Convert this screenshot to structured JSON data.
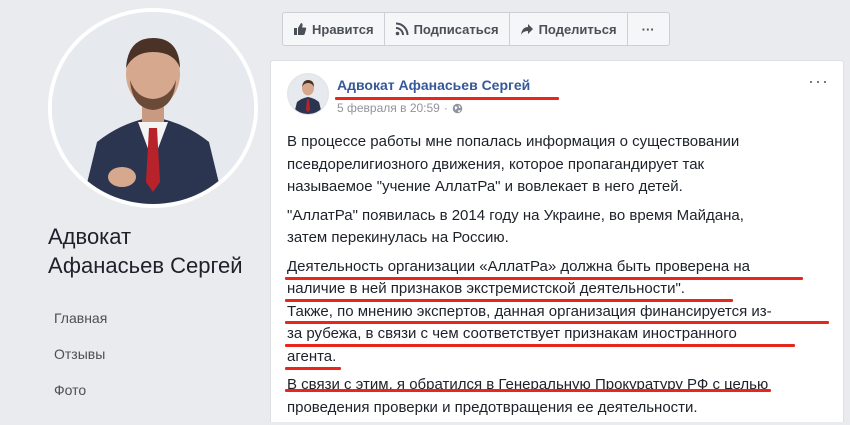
{
  "profile": {
    "name_line1": "Адвокат",
    "name_line2": "Афанасьев Сергей"
  },
  "nav": {
    "items": [
      "Главная",
      "Отзывы",
      "Фото"
    ]
  },
  "actions": {
    "like": "Нравится",
    "subscribe": "Подписаться",
    "share": "Поделиться",
    "more": "···"
  },
  "post": {
    "author": "Адвокат Афанасьев Сергей",
    "date": "5 февраля в 20:59",
    "more": "···",
    "paragraphs": [
      [
        "В процессе работы мне попалась информация о существовании",
        "псевдорелигиозного движения, которое пропагандирует так",
        "называемое \"учение АллатРа\" и вовлекает в него детей."
      ],
      [
        "\"АллатРа\" появилась в 2014 году на Украине, во время Майдана,",
        "затем перекинулась на Россию."
      ],
      [
        "Деятельность организации «АллатРа» должна быть проверена на",
        "наличие в ней признаков экстремистской деятельности\".",
        "Также, по мнению экспертов, данная организация финансируется из-",
        "за рубежа, в связи с чем соответствует признакам иностранного",
        "агента."
      ],
      [
        "В связи с этим, я обратился в Генеральную Прокуратуру РФ с целью",
        "проведения проверки и предотвращения ее деятельности."
      ]
    ]
  },
  "colors": {
    "background": "#e9ebee",
    "link": "#365899",
    "annotation": "#e8271c"
  }
}
